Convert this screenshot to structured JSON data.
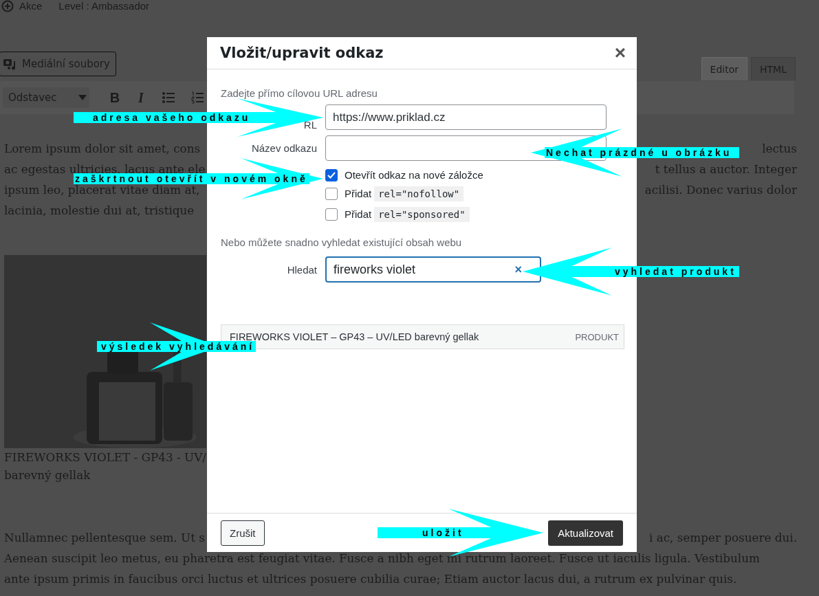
{
  "top_bar": {
    "action": "Akce",
    "level": "Level : Ambassador"
  },
  "media_button": "Mediální soubory",
  "editor_tabs": [
    {
      "label": "Editor",
      "selected": true
    },
    {
      "label": "HTML",
      "selected": false
    }
  ],
  "toolbar": {
    "format": "Odstavec",
    "bold": "B",
    "italic": "I"
  },
  "content": {
    "lines_top": [
      {
        "left": "Lorem ipsum dolor sit amet, cons",
        "right": "lectus"
      },
      {
        "left": "ac egestas ultricies, lacus ante ele",
        "right": "t tellus a auctor. Integer"
      },
      {
        "left": "ipsum leo, placerat vitae diam at,",
        "right": "acilisi. Donec varius dolor"
      },
      {
        "left": "lacinia, molestie dui at, tristique"
      }
    ],
    "caption": [
      "FIREWORKS VIOLET - GP43 - UV/",
      "barevný gellak"
    ],
    "lines_bottom": [
      {
        "left": "Nullamnec pellentesque sem. Ut s",
        "right": "i ac, semper posuere dui."
      }
    ],
    "lines_full": [
      "Aenean suscipit leo metus, eu pharetra est feugiat vitae. Fusce a nibh eget mi rutrum laoreet. Fusce ut iaculis ligula. Vestibulum",
      "ante ipsum primis in faucibus orci luctus et ultrices posuere cubilia curae; Etiam auctor lacus dui, a rutrum ex pulvinar quis."
    ]
  },
  "dialog": {
    "title": "Vložit/upravit odkaz",
    "close": "×",
    "url_intro": "Zadejte přímo cílovou URL adresu",
    "url_label": "RL",
    "url_value": "https://www.priklad.cz",
    "name_label": "Název odkazu",
    "options": [
      {
        "label": "Otevřít odkaz na nové záložce",
        "checked": true
      },
      {
        "label": "Přidat",
        "code": "rel=\"nofollow\"",
        "checked": false
      },
      {
        "label": "Přidat",
        "code": "rel=\"sponsored\"",
        "checked": false
      }
    ],
    "search_intro": "Nebo můžete snadno vyhledat existující obsah webu",
    "search_label": "Hledat",
    "search_value": "fireworks violet",
    "search_clear": "×",
    "results": [
      {
        "title": "FIREWORKS VIOLET – GP43 – UV/LED barevný gellak",
        "type": "PRODUKT"
      }
    ],
    "cancel": "Zrušit",
    "submit": "Aktualizovat"
  },
  "annotations": [
    "adresa vašeho odkazu",
    "Nechat prázdné u obrázku",
    "zaškrtnout otevřít v novém okně",
    "vyhledat produkt",
    "výsledek vyhledávání",
    "uložit"
  ]
}
